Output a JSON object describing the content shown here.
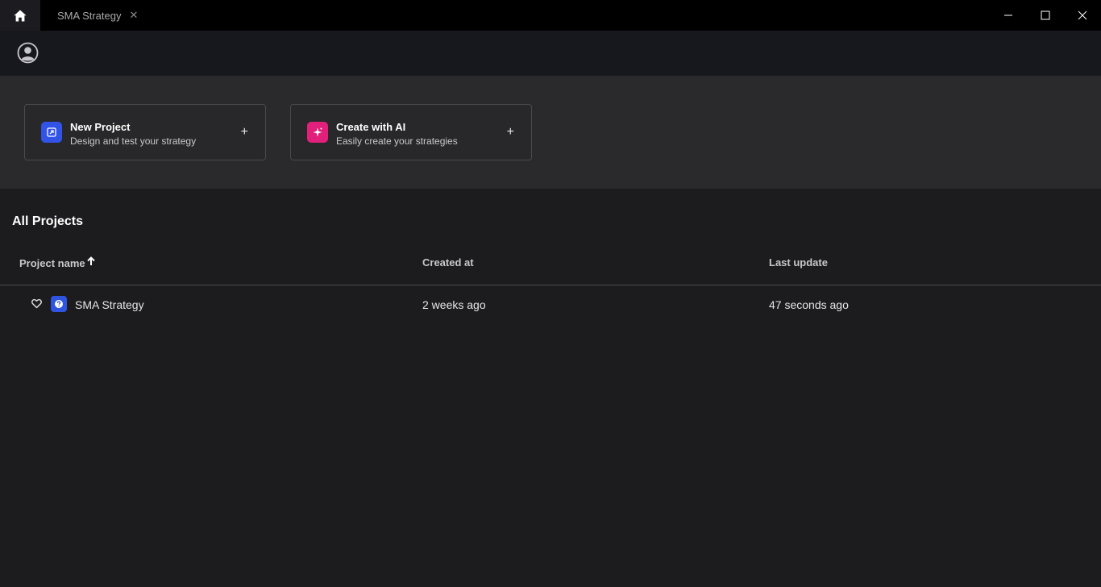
{
  "titlebar": {
    "home_icon": "home-icon",
    "tab": {
      "label": "SMA Strategy",
      "close_glyph": "✕"
    },
    "controls": [
      "minimize-icon",
      "maximize-icon",
      "close-icon"
    ]
  },
  "header": {
    "avatar_icon": "user-circle-icon"
  },
  "cards": [
    {
      "title": "New Project",
      "subtitle": "Design and test your strategy",
      "icon": "external-link-icon",
      "icon_color": "#3153e6",
      "plus": "+"
    },
    {
      "title": "Create with AI",
      "subtitle": "Easily create your strategies",
      "icon": "sparkle-icon",
      "icon_color": "#e0207a",
      "plus": "+"
    }
  ],
  "projects": {
    "title": "All Projects",
    "columns": {
      "name": "Project name",
      "sort_icon": "arrow-up-icon",
      "created": "Created at",
      "updated": "Last update"
    },
    "rows": [
      {
        "favorite_icon": "heart-icon",
        "icon": "project-icon",
        "name": "SMA Strategy",
        "created": "2 weeks ago",
        "updated": "47 seconds ago"
      }
    ]
  },
  "colors": {
    "titlebar_bg": "#000000",
    "header_bg": "#17171e",
    "hero_bg": "#2a2a2c",
    "page_bg": "#1c1c1f",
    "accent_blue": "#2f55e0",
    "accent_pink": "#e0207a"
  }
}
